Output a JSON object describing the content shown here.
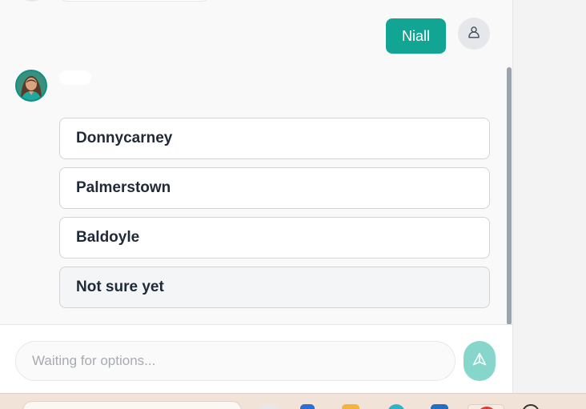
{
  "chat": {
    "user_message": "Niall",
    "options": [
      {
        "label": "Donnycarney"
      },
      {
        "label": "Palmerstown"
      },
      {
        "label": "Baldoyle"
      },
      {
        "label": "Not sure yet"
      }
    ]
  },
  "input": {
    "placeholder": "Waiting for options..."
  },
  "icons": {
    "user_avatar": "person-icon",
    "bot_avatar": "assistant-avatar",
    "send": "send-icon"
  },
  "colors": {
    "accent": "#12a594",
    "send_disabled": "#86d6cc"
  },
  "taskbar": {
    "apps": [
      "explorer-icon",
      "store-icon",
      "folder-icon",
      "edge-icon",
      "outlook-icon",
      "chrome-icon",
      "copilot-icon"
    ]
  }
}
